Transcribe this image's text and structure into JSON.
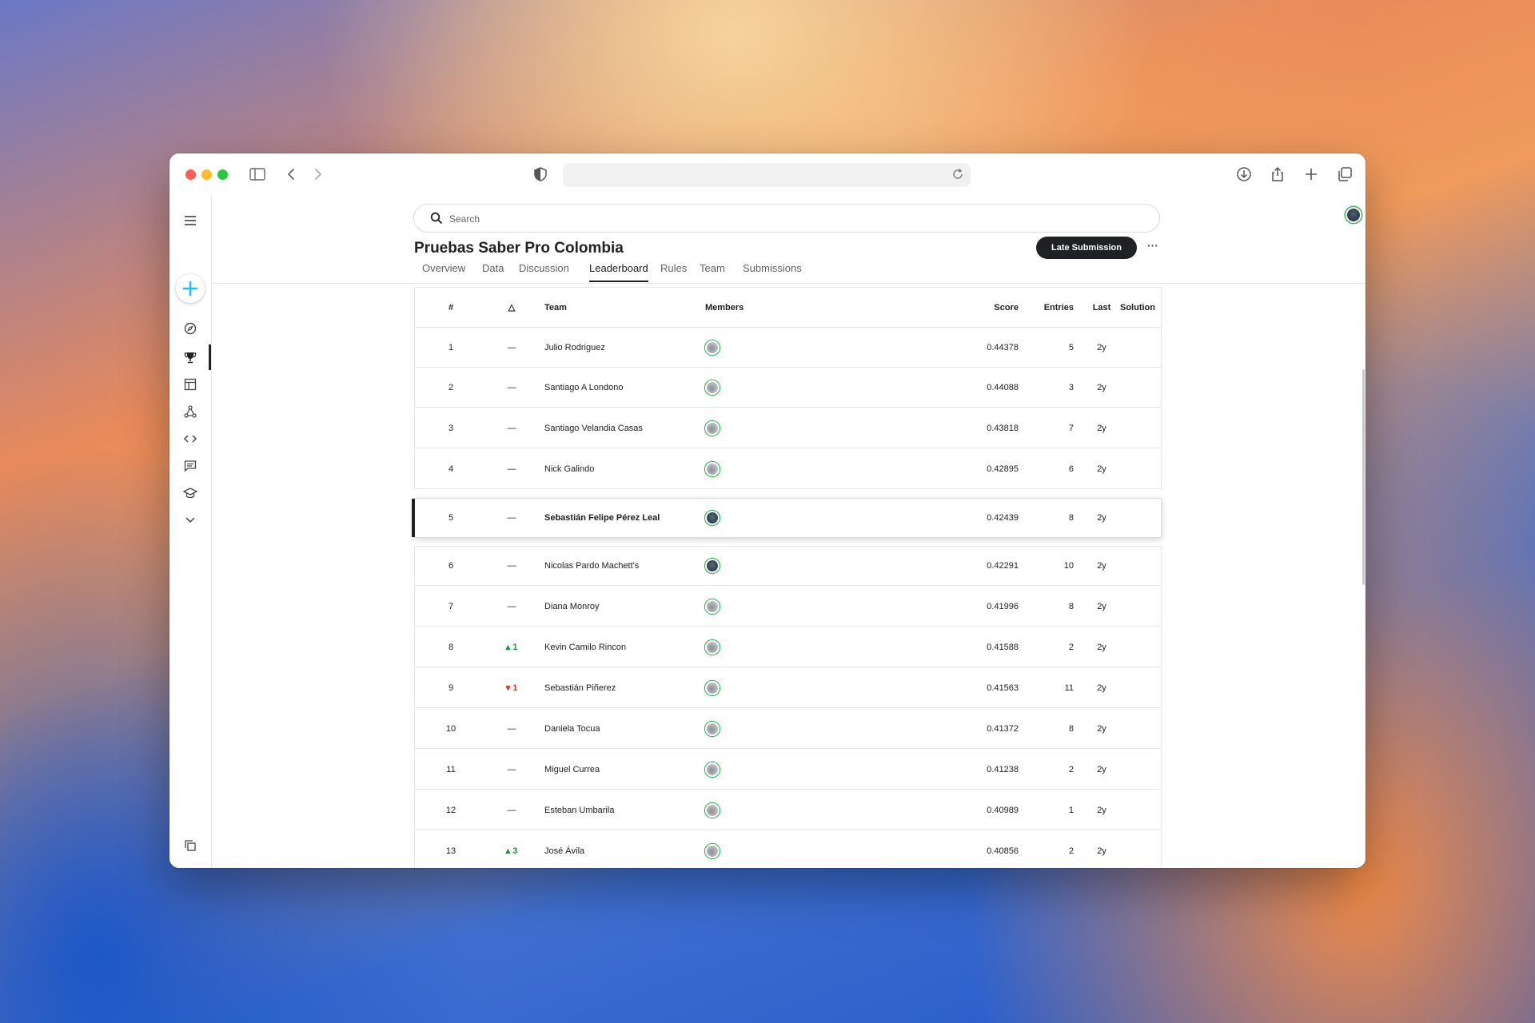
{
  "browser": {
    "url": "",
    "icons": [
      "sidebar-icon",
      "back-icon",
      "forward-icon",
      "shield-icon",
      "reload-icon",
      "download-icon",
      "share-icon",
      "new-tab-icon",
      "tabs-icon"
    ]
  },
  "search": {
    "placeholder": "Search"
  },
  "competition": {
    "title": "Pruebas Saber Pro Colombia",
    "late_submission_label": "Late Submission",
    "more_label": "···",
    "tabs": [
      "Overview",
      "Data",
      "Discussion",
      "Leaderboard",
      "Rules",
      "Team",
      "Submissions"
    ],
    "active_tab": "Leaderboard"
  },
  "leaderboard": {
    "headers": {
      "rank": "#",
      "delta": "△",
      "team": "Team",
      "members": "Members",
      "score": "Score",
      "entries": "Entries",
      "last": "Last",
      "solution": "Solution"
    },
    "rows": [
      {
        "rank": "1",
        "delta": "—",
        "team": "Julio Rodriguez",
        "score": "0.44378",
        "entries": "5",
        "last": "2y"
      },
      {
        "rank": "2",
        "delta": "—",
        "team": "Santiago A Londono",
        "score": "0.44088",
        "entries": "3",
        "last": "2y"
      },
      {
        "rank": "3",
        "delta": "—",
        "team": "Santiago Velandia Casas",
        "score": "0.43818",
        "entries": "7",
        "last": "2y"
      },
      {
        "rank": "4",
        "delta": "—",
        "team": "Nick Galindo",
        "score": "0.42895",
        "entries": "6",
        "last": "2y"
      },
      {
        "rank": "5",
        "delta": "—",
        "team": "Sebastián Felipe Pérez Leal",
        "score": "0.42439",
        "entries": "8",
        "last": "2y"
      },
      {
        "rank": "6",
        "delta": "—",
        "team": "Nicolas Pardo Machett's",
        "score": "0.42291",
        "entries": "10",
        "last": "2y"
      },
      {
        "rank": "7",
        "delta": "—",
        "team": "Diana Monroy",
        "score": "0.41996",
        "entries": "8",
        "last": "2y"
      },
      {
        "rank": "8",
        "delta": "▴ 1",
        "team": "Kevin Camilo Rincon",
        "score": "0.41588",
        "entries": "2",
        "last": "2y"
      },
      {
        "rank": "9",
        "delta": "▾ 1",
        "team": "Sebastián Piñerez",
        "score": "0.41563",
        "entries": "11",
        "last": "2y"
      },
      {
        "rank": "10",
        "delta": "—",
        "team": "Daniela Tocua",
        "score": "0.41372",
        "entries": "8",
        "last": "2y"
      },
      {
        "rank": "11",
        "delta": "—",
        "team": "Miguel Currea",
        "score": "0.41238",
        "entries": "2",
        "last": "2y"
      },
      {
        "rank": "12",
        "delta": "—",
        "team": "Esteban Umbarila",
        "score": "0.40989",
        "entries": "1",
        "last": "2y"
      },
      {
        "rank": "13",
        "delta": "▴ 3",
        "team": "José Ávila",
        "score": "0.40856",
        "entries": "2",
        "last": "2y"
      }
    ]
  },
  "colors": {
    "accent_green": "#1e8e3e",
    "accent_red": "#d93025",
    "create_blue": "#20beff",
    "dark": "#202124"
  }
}
